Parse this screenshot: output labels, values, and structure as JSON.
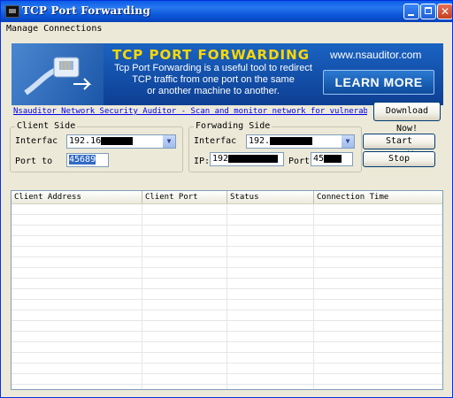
{
  "window": {
    "title": "TCP Port Forwarding"
  },
  "menu": {
    "items": [
      "Manage Connections"
    ]
  },
  "banner": {
    "title": "TCP PORT FORWARDING",
    "description_lines": [
      "Tcp Port Forwarding is a useful tool to redirect",
      "TCP  traffic from one port on the same",
      "or another machine to another."
    ],
    "url": "www.nsauditor.com",
    "cta_label": "LEARN MORE"
  },
  "link": {
    "text": "Nsauditor Network Security Auditor - Scan and monitor network for vulnerabilities."
  },
  "buttons": {
    "download": "Download Now!",
    "start": "Start Forwarding",
    "stop": "Stop"
  },
  "client_side": {
    "title": "Client Side",
    "interface_label": "Interfac",
    "interface_value": "192.16",
    "port_label": "Port to",
    "port_value": "45689"
  },
  "forwarding_side": {
    "title": "Forwading Side",
    "interface_label": "Interfac",
    "interface_value": "192.",
    "ip_label": "IP:",
    "ip_value": "192",
    "port_label": "Port",
    "port_value": "45"
  },
  "table": {
    "columns": [
      "Client Address",
      "Client Port",
      "Status",
      "Connection Time"
    ],
    "rows": []
  },
  "colors": {
    "title_bar": "#0a55d8",
    "banner_bg": "#1a63c2",
    "banner_title": "#ffd700",
    "link": "#0000ee",
    "selection": "#316ac5"
  }
}
